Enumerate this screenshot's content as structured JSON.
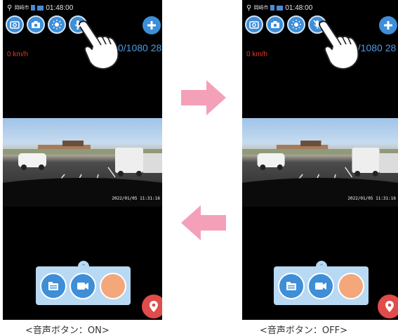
{
  "panels": [
    {
      "status": {
        "location": "岡崎市",
        "time": "01:48:00"
      },
      "resolution": "0/1080 28",
      "speed": "0 km/h",
      "timestamp": "2022/01/05 11:31:16",
      "caption": "<音声ボタン：ON>",
      "mic_state": "on",
      "icons": [
        "camera-switch-icon",
        "photo-camera-icon",
        "brightness-icon",
        "microphone-icon",
        "plus-icon",
        "folder-icon",
        "video-camera-icon",
        "record-icon",
        "map-pin-icon",
        "pointing-hand-icon",
        "collapse-up-icon"
      ]
    },
    {
      "status": {
        "location": "岡崎市",
        "time": "01:48:00"
      },
      "resolution": "0/1080 28",
      "speed": "0 km/h",
      "timestamp": "2022/01/05 11:31:16",
      "caption": "<音声ボタン：OFF>",
      "mic_state": "off",
      "icons": [
        "camera-switch-icon",
        "photo-camera-icon",
        "brightness-icon",
        "microphone-off-icon",
        "plus-icon",
        "folder-icon",
        "video-camera-icon",
        "record-icon",
        "map-pin-icon",
        "pointing-hand-icon",
        "collapse-up-icon"
      ]
    }
  ],
  "colors": {
    "accent_blue": "#3e8ed8",
    "panel_blue": "#b8d9f4",
    "speed_red": "#e23a2a",
    "arrow_pink": "#f4a0b8",
    "record_orange": "#f3a77a"
  }
}
